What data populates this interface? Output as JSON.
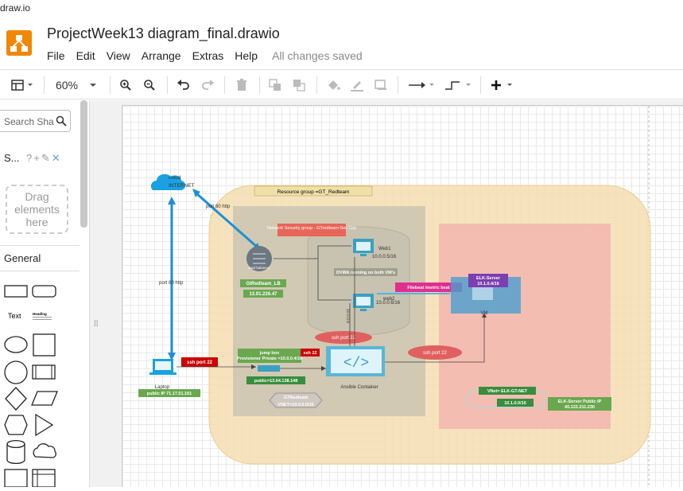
{
  "window": {
    "title": "draw.io"
  },
  "header": {
    "doc_title": "ProjectWeek13 diagram_final.drawio",
    "menu": [
      "File",
      "Edit",
      "View",
      "Arrange",
      "Extras",
      "Help"
    ],
    "status": "All changes saved"
  },
  "toolbar": {
    "zoom": "60%"
  },
  "sidebar": {
    "search_placeholder": "Search Sha",
    "scratchpad_title": "S...",
    "drag_text": "Drag elements here",
    "general_title": "General",
    "text_shape_label": "Text",
    "heading_shape_label": "Heading"
  },
  "diagram": {
    "resource_group": "Resource group =GT_Redteam",
    "cloud_label": "cloud",
    "internet_label": "INTERNET",
    "port80_a": "port 80 http",
    "port80_b": "port 80 http",
    "nsg": "Network Security group - GTredteam-Sec-Grp",
    "lb_name": "GtRedteam_LB",
    "lb_ip": "13.91.226.47",
    "lb_icon_label": "load balancer",
    "web1": "Web1",
    "web1_ip": "10.0.0.5/16",
    "web2": "web2",
    "web2_ip": "10.0.0.6/16",
    "dvwa": "DVWA running on both VM's",
    "filebeat": "Filebeat /metric beat",
    "elk_server": "ELK-Server",
    "elk_ip": "10.1.0.4/16",
    "vm_label": "VM",
    "ssh22_laptop": "ssh port 22",
    "ssh22_jump": "ssh 22",
    "ssh22_web": "ssh port 22",
    "ssh22_elk": "ssh port 22",
    "jumpbox": "jump box Provisioner Private =10.0.0.4/16",
    "jump_public": "public=13.64.138.148",
    "ansible": "Ansible Container",
    "vnet_red": "GTRedteam VNET=10.0.0.0/16",
    "laptop": "Laptop",
    "laptop_ip": "public IP 71.17.51.161",
    "vnet_elk": "VNet= ELK-GT-NET",
    "vnet_elk_ip": "10.1.0.0/16",
    "elk_public": "ELK-Server Public IP 40.122.211.230",
    "vertical_ip": "10.0.0.6"
  },
  "colors": {
    "accent": "#f08705",
    "rg_fill": "#f5deb3",
    "elk_fill": "#f4b8b0",
    "gray_fill": "#c8c2b0",
    "green_box": "#6aa84f",
    "red_box": "#cc0000",
    "arrow_blue": "#1d8fd8"
  }
}
